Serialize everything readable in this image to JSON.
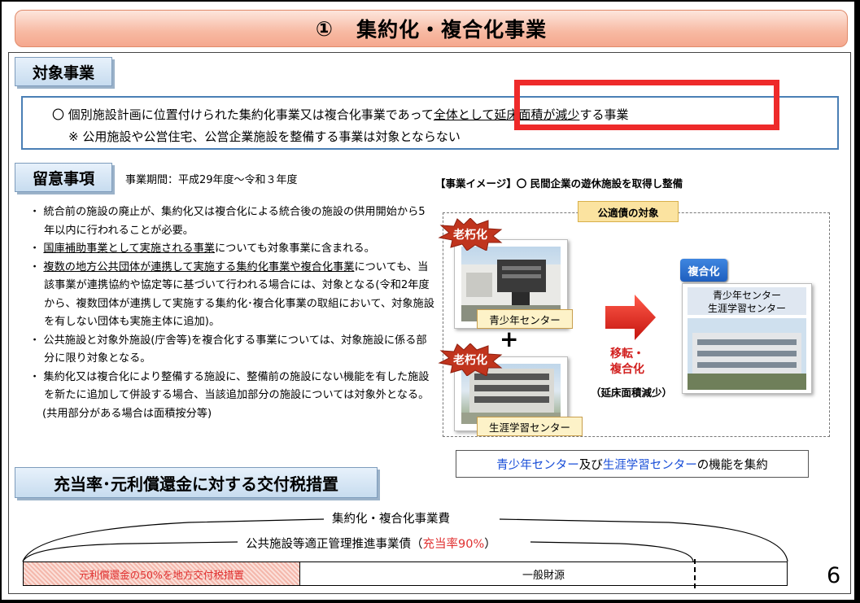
{
  "title": {
    "number": "①",
    "text": "集約化・複合化事業"
  },
  "sections": {
    "target": "対象事業",
    "notes": "留意事項",
    "fiscal": "充当率･元利償還金に対する交付税措置"
  },
  "target": {
    "line1_prefix": "〇 個別施設計画に位置付けられた集約化事業又は複合化事業であって",
    "line1_underlined": "全体として延床面積が減少",
    "line1_suffix": "する事業",
    "line2": "※ 公用施設や公営住宅、公営企業施設を整備する事業は対象とならない"
  },
  "period": "事業期間：平成29年度～令和３年度",
  "notes": {
    "n1": "・ 統合前の施設の廃止が、集約化又は複合化による統合後の施設の供用開始から5年以内に行われることが必要。",
    "n2_bullet": "・ ",
    "n2_underlined": "国庫補助事業として実施される事業",
    "n2_rest": "についても対象事業に含まれる。",
    "n3_bullet": "・ ",
    "n3_underlined": "複数の地方公共団体が連携して実施する集約化事業や複合化事業",
    "n3_rest": "についても、当該事業が連携協約や協定等に基づいて行われる場合には、対象となる(令和2年度から、複数団体が連携して実施する集約化･複合化事業の取組において、対象施設を有しない団体も実施主体に追加)。",
    "n4": "・ 公共施設と対象外施設(庁舎等)を複合化する事業については、対象施設に係る部分に限り対象となる。",
    "n5": "・ 集約化又は複合化により整備する施設に、整備前の施設にない機能を有した施設を新たに追加して併設する場合、当該追加部分の施設については対象外となる。",
    "n5_sub": "(共用部分がある場合は面積按分等)"
  },
  "image": {
    "title": "【事業イメージ】〇 民間企業の遊休施設を取得し整備",
    "kousai_tag": "公適債の対象",
    "aging": "老朽化",
    "youth_center": "青少年センター",
    "plus": "+",
    "lifelong_center": "生涯学習センター",
    "move_line1": "移転・",
    "move_line2": "複合化",
    "reduction": "（延床面積減少）",
    "fukugo_badge": "複合化",
    "combined_line1": "青少年センター",
    "combined_line2": "生涯学習センター",
    "summary_a": "青少年センター",
    "summary_mid": "及び",
    "summary_b": "生涯学習センター",
    "summary_end": "の機能を集約"
  },
  "fiscal": {
    "cost_total": "集約化・複合化事業費",
    "bond_prefix": "公共施設等適正管理推進事業債（",
    "bond_rate": "充当率90%",
    "bond_suffix": "）",
    "portion_a": "元利償還金の50%を地方交付税措置",
    "portion_b": "一般財源"
  },
  "page_number": "6",
  "colors": {
    "accent_red": "#ee2a2a",
    "blue_text": "#1a4fd8",
    "badge_blue": "#1f5fbf",
    "title_bg": "#f7b9a2"
  }
}
